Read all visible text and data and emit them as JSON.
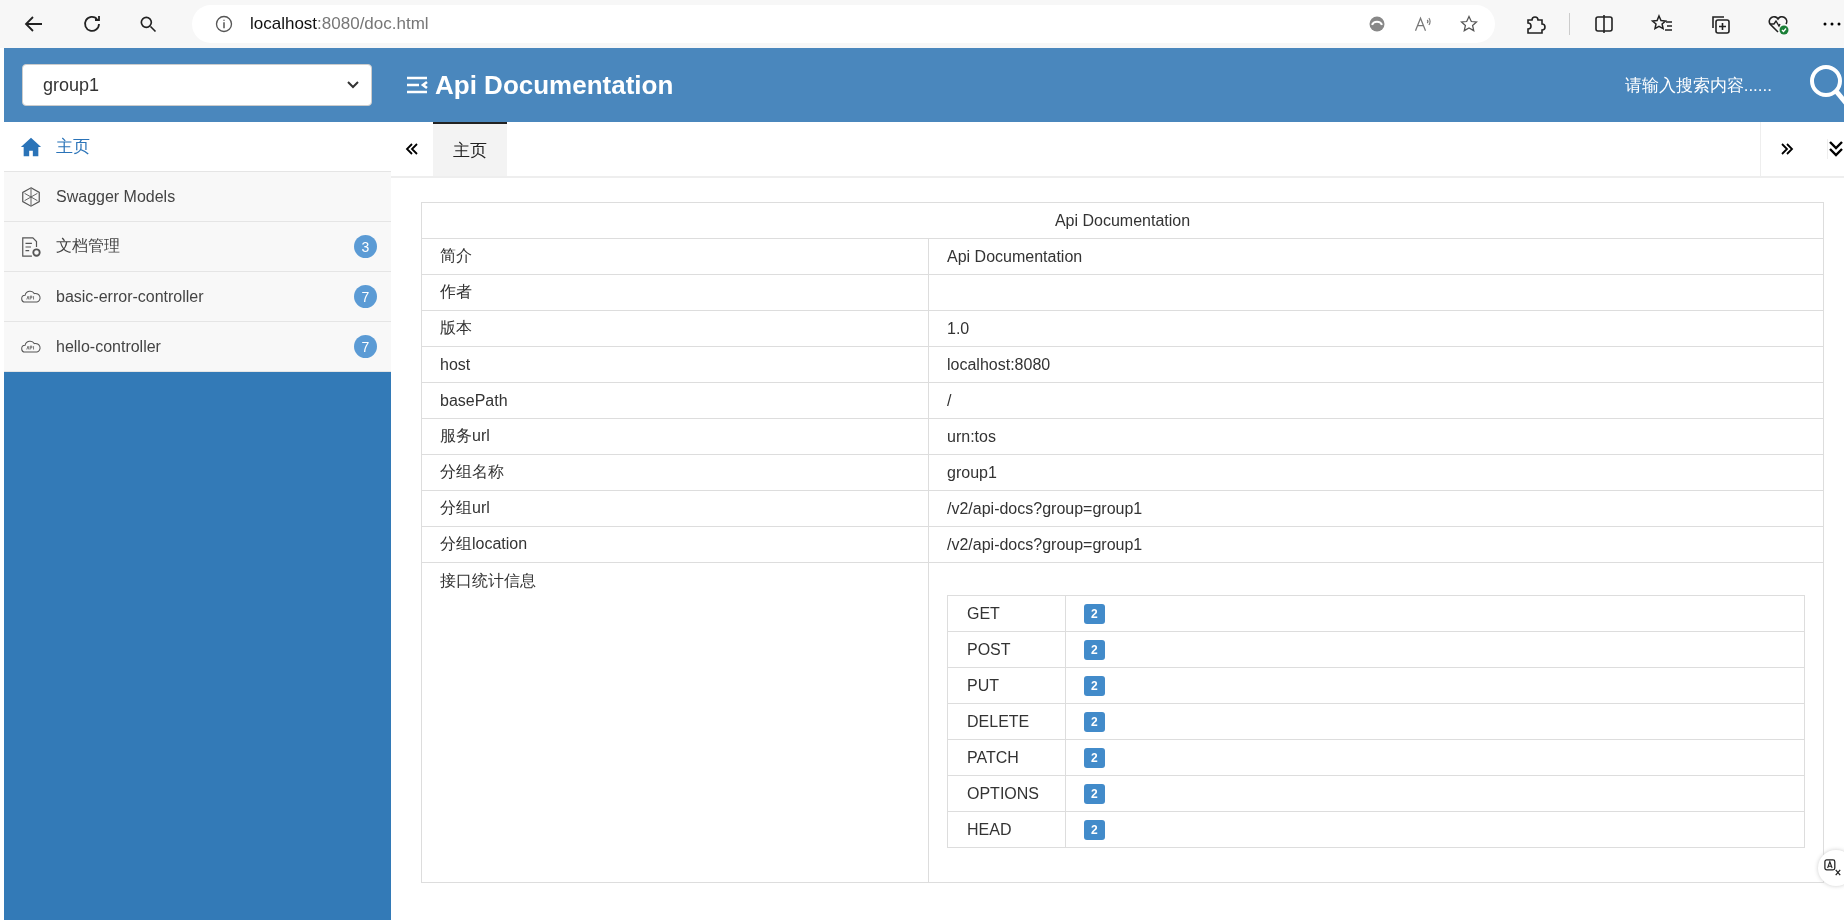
{
  "browser": {
    "address_host": "localhost",
    "address_rest": ":8080/doc.html"
  },
  "header": {
    "group_select": "group1",
    "title": "Api Documentation",
    "search_placeholder": "请输入搜索内容......"
  },
  "sidebar": {
    "items": [
      {
        "label": "主页",
        "kind": "home",
        "selected": true
      },
      {
        "label": "Swagger Models",
        "kind": "models",
        "selected": false
      },
      {
        "label": "文档管理",
        "kind": "docs",
        "badge": "3",
        "selected": false
      },
      {
        "label": "basic-error-controller",
        "kind": "api",
        "badge": "7",
        "selected": false
      },
      {
        "label": "hello-controller",
        "kind": "api",
        "badge": "7",
        "selected": false
      }
    ]
  },
  "tabs": [
    {
      "label": "主页",
      "selected": true
    }
  ],
  "info_table": {
    "title": "Api Documentation",
    "rows": [
      {
        "label": "简介",
        "value": "Api Documentation"
      },
      {
        "label": "作者",
        "value": ""
      },
      {
        "label": "版本",
        "value": "1.0"
      },
      {
        "label": "host",
        "value": "localhost:8080"
      },
      {
        "label": "basePath",
        "value": "/"
      },
      {
        "label": "服务url",
        "value": "urn:tos"
      },
      {
        "label": "分组名称",
        "value": "group1"
      },
      {
        "label": "分组url",
        "value": "/v2/api-docs?group=group1"
      },
      {
        "label": "分组location",
        "value": "/v2/api-docs?group=group1"
      }
    ],
    "stats_label": "接口统计信息",
    "stats": [
      {
        "method": "GET",
        "count": "2"
      },
      {
        "method": "POST",
        "count": "2"
      },
      {
        "method": "PUT",
        "count": "2"
      },
      {
        "method": "DELETE",
        "count": "2"
      },
      {
        "method": "PATCH",
        "count": "2"
      },
      {
        "method": "OPTIONS",
        "count": "2"
      },
      {
        "method": "HEAD",
        "count": "2"
      }
    ]
  }
}
